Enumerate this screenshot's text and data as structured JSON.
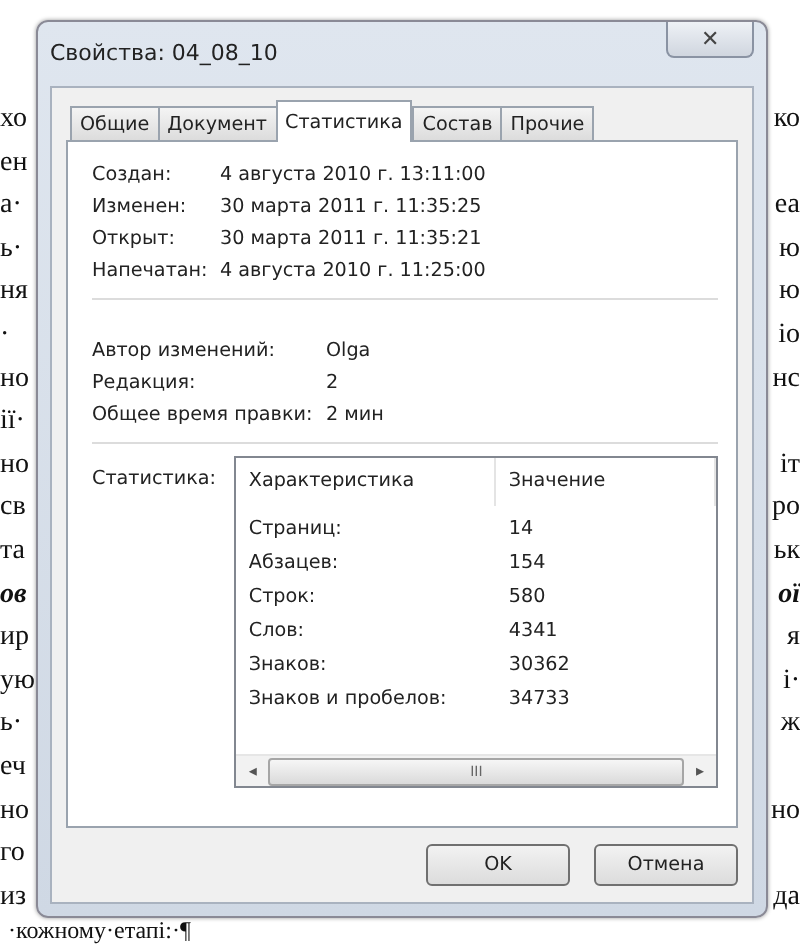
{
  "document": {
    "lines": [
      {
        "left": "хо",
        "right": "ко"
      },
      {
        "left": "ен"
      },
      {
        "left": "а·",
        "right": "еа"
      },
      {
        "left": "ь·",
        "right": "ю"
      },
      {
        "left": "ня",
        "right": "ю"
      },
      {
        "left": "·",
        "right": "іо"
      },
      {
        "left": "но",
        "right": "нс"
      },
      {
        "left": "ії·"
      },
      {
        "left": "но",
        "right": "іт"
      },
      {
        "left": "св",
        "right": "ро"
      },
      {
        "left": "та",
        "right": "ьк"
      },
      {
        "left": "ов",
        "right": "ої",
        "emphasis": true
      },
      {
        "left": "ир",
        "right": "я"
      },
      {
        "left": "ую",
        "right": "і·"
      },
      {
        "left": "ь·",
        "right": "ж"
      },
      {
        "left": "еч"
      },
      {
        "left": "но",
        "right": "но"
      },
      {
        "left": "го"
      },
      {
        "left": "из",
        "right": "да"
      }
    ],
    "last_line": "·кожному·етапі:·¶"
  },
  "window": {
    "title": "Свойства: 04_08_10",
    "close": "✕"
  },
  "tabs": [
    {
      "label": "Общие",
      "selected": false
    },
    {
      "label": "Документ",
      "selected": false
    },
    {
      "label": "Статистика",
      "selected": true
    },
    {
      "label": "Состав",
      "selected": false
    },
    {
      "label": "Прочие",
      "selected": false
    }
  ],
  "dates": [
    {
      "label": "Создан:",
      "value": "4 августа 2010 г. 13:11:00"
    },
    {
      "label": "Изменен:",
      "value": "30 марта 2011 г. 11:35:25"
    },
    {
      "label": "Открыт:",
      "value": "30 марта 2011 г. 11:35:21"
    },
    {
      "label": "Напечатан:",
      "value": "4 августа 2010 г. 11:25:00"
    }
  ],
  "info": [
    {
      "label": "Автор изменений:",
      "value": "Olga"
    },
    {
      "label": "Редакция:",
      "value": "2"
    },
    {
      "label": "Общее время правки:",
      "value": "2 мин"
    }
  ],
  "statistics": {
    "label": "Статистика:",
    "columns": [
      "Характеристика",
      "Значение"
    ],
    "rows": [
      {
        "name": "Страниц:",
        "value": "14"
      },
      {
        "name": "Абзацев:",
        "value": "154"
      },
      {
        "name": "Строк:",
        "value": "580"
      },
      {
        "name": "Слов:",
        "value": "4341"
      },
      {
        "name": "Знаков:",
        "value": "30362"
      },
      {
        "name": "Знаков и пробелов:",
        "value": "34733"
      }
    ],
    "scroll_left": "◂",
    "scroll_grip": "III",
    "scroll_right": "▸"
  },
  "buttons": [
    "OK",
    "Отмена"
  ]
}
